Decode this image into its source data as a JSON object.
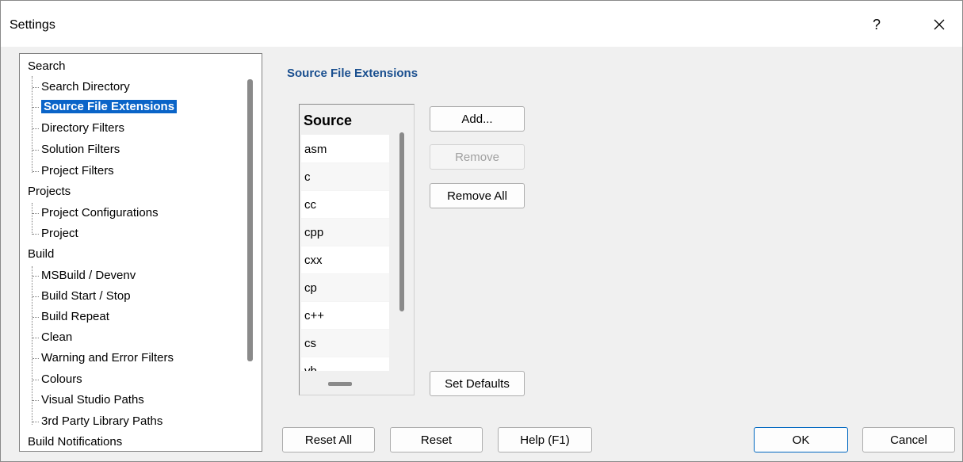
{
  "window": {
    "title": "Settings",
    "help_label": "?",
    "close_label": "×"
  },
  "tree": {
    "groups": [
      {
        "label": "Search",
        "children": [
          "Search Directory",
          "Source File Extensions",
          "Directory Filters",
          "Solution Filters",
          "Project Filters"
        ]
      },
      {
        "label": "Projects",
        "children": [
          "Project Configurations",
          "Project"
        ]
      },
      {
        "label": "Build",
        "children": [
          "MSBuild / Devenv",
          "Build Start / Stop",
          "Build Repeat",
          "Clean",
          "Warning and Error Filters",
          "Colours",
          "Visual Studio Paths",
          "3rd Party Library Paths"
        ]
      },
      {
        "label": "Build Notifications",
        "children": []
      }
    ],
    "selected": "Source File Extensions"
  },
  "panel": {
    "title": "Source File Extensions",
    "list": {
      "header": "Source",
      "rows": [
        "asm",
        "c",
        "cc",
        "cpp",
        "cxx",
        "cp",
        "c++",
        "cs",
        "vb"
      ]
    },
    "buttons": {
      "add": "Add...",
      "remove": "Remove",
      "remove_all": "Remove All",
      "set_defaults": "Set Defaults"
    }
  },
  "footer": {
    "reset_all": "Reset All",
    "reset": "Reset",
    "help": "Help (F1)",
    "ok": "OK",
    "cancel": "Cancel"
  }
}
